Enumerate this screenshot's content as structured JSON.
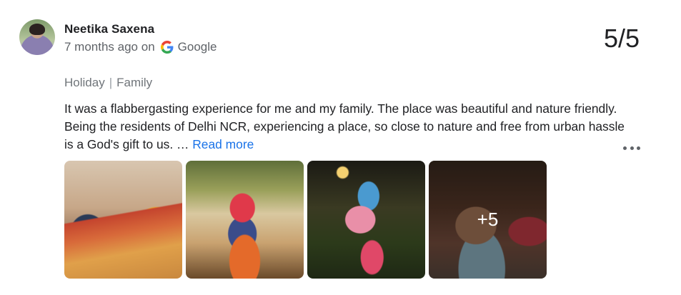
{
  "reviewer": {
    "name": "Neetika Saxena",
    "time": "7 months ago on",
    "source": "Google"
  },
  "rating": "5/5",
  "tags": {
    "first": "Holiday",
    "separator": "|",
    "second": "Family"
  },
  "review": {
    "text": "It was a flabbergasting experience for me and my family. The place was beautiful and nature friendly. Being the residents of Delhi NCR, experiencing a place, so close to nature and free from urban hassle is a God's gift to us. …",
    "more_label": "Read more"
  },
  "photos": {
    "extra_count": "+5"
  },
  "icons": {
    "source_icon": "google-g-icon",
    "menu_icon": "more-options-icon"
  },
  "colors": {
    "link": "#1a73e8",
    "muted": "#5f6368"
  }
}
